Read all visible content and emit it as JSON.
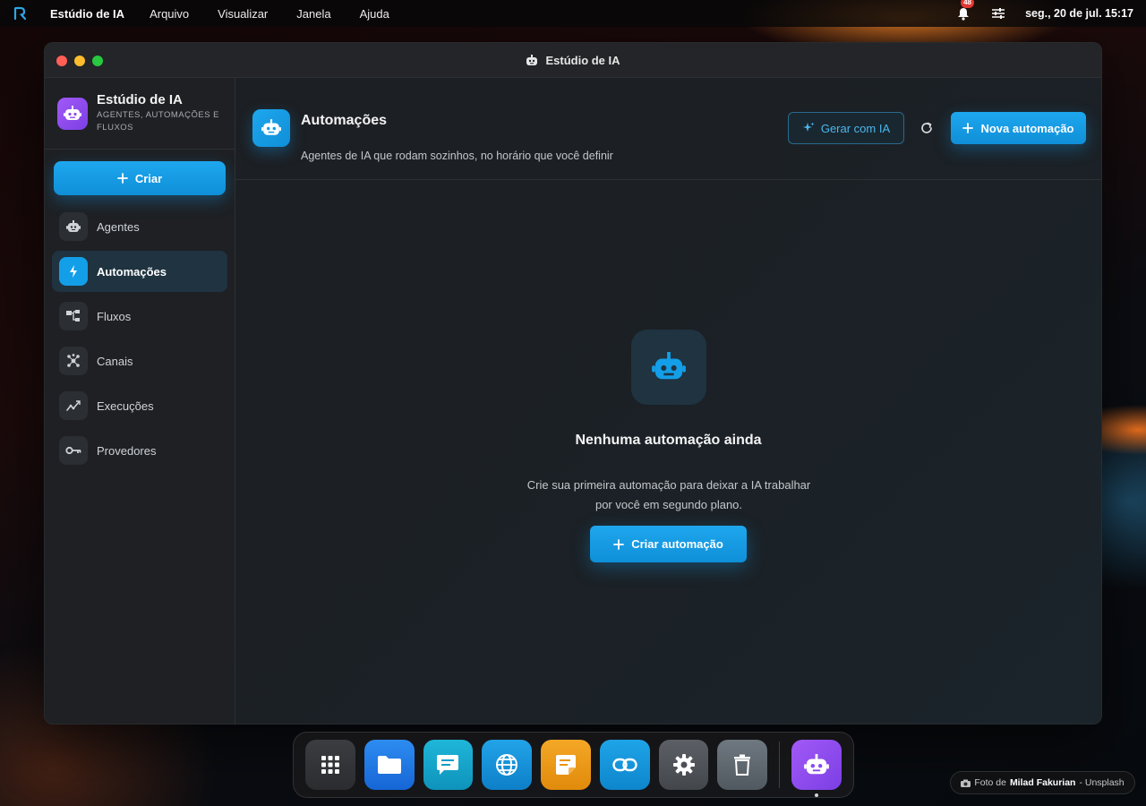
{
  "menubar": {
    "app_name": "Estúdio de IA",
    "menus": [
      "Arquivo",
      "Visualizar",
      "Janela",
      "Ajuda"
    ],
    "notification_count": "48",
    "datetime": "seg., 20 de jul. 15:17"
  },
  "window": {
    "title": "Estúdio de IA"
  },
  "sidebar": {
    "brand_title": "Estúdio de IA",
    "brand_subtitle": "AGENTES, AUTOMAÇÕES E FLUXOS",
    "create_label": "Criar",
    "items": [
      {
        "label": "Agentes",
        "icon": "robot-icon"
      },
      {
        "label": "Automações",
        "icon": "bolt-icon",
        "active": true
      },
      {
        "label": "Fluxos",
        "icon": "flow-icon"
      },
      {
        "label": "Canais",
        "icon": "hub-icon"
      },
      {
        "label": "Execuções",
        "icon": "activity-icon"
      },
      {
        "label": "Provedores",
        "icon": "key-icon"
      }
    ]
  },
  "header": {
    "title": "Automações",
    "subtitle": "Agentes de IA que rodam sozinhos, no horário que você definir",
    "generate_label": "Gerar com IA",
    "new_label": "Nova automação"
  },
  "empty_state": {
    "title": "Nenhuma automação ainda",
    "description_line1": "Crie sua primeira automação para deixar a IA trabalhar",
    "description_line2": "por você em segundo plano.",
    "button_label": "Criar automação"
  },
  "dock": {
    "items": [
      "apps-grid-icon",
      "folder-icon",
      "chat-icon",
      "globe-icon",
      "notes-icon",
      "link-icon",
      "settings-icon",
      "trash-icon",
      "robot-icon"
    ]
  },
  "credit": {
    "prefix": "Foto de",
    "author": "Milad Fakurian",
    "suffix": "- Unsplash"
  },
  "colors": {
    "accent": "#139ee8",
    "brand_purple": "#8f4cf0"
  }
}
